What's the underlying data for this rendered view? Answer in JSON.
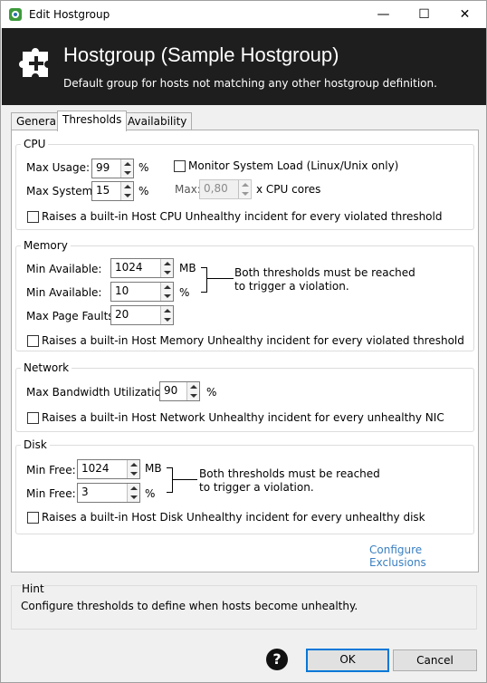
{
  "window": {
    "title": "Edit Hostgroup",
    "controls": {
      "minimize": "—",
      "maximize": "☐",
      "close": "✕"
    }
  },
  "header": {
    "title": "Hostgroup (Sample Hostgroup)",
    "subtitle": "Default group for hosts not matching any other hostgroup definition."
  },
  "tabs": [
    {
      "label": "General",
      "active": false
    },
    {
      "label": "Thresholds",
      "active": true
    },
    {
      "label": "Availability",
      "active": false
    }
  ],
  "cpu": {
    "legend": "CPU",
    "max_usage_label": "Max Usage:",
    "max_usage_value": "99",
    "max_usage_unit": "%",
    "max_system_label": "Max System:",
    "max_system_value": "15",
    "max_system_unit": "%",
    "monitor_load_label": "Monitor System Load (Linux/Unix only)",
    "monitor_load_checked": false,
    "max_label": "Max:",
    "max_value": "0,80",
    "max_unit": "x CPU cores",
    "incident_label": "Raises a built-in Host CPU Unhealthy incident for every violated threshold",
    "incident_checked": false
  },
  "memory": {
    "legend": "Memory",
    "min_available_label": "Min Available:",
    "min_available_mb_value": "1024",
    "min_available_mb_unit": "MB",
    "min_available_pct_label": "Min Available:",
    "min_available_pct_value": "10",
    "min_available_pct_unit": "%",
    "note_line1": "Both thresholds must be reached",
    "note_line2": "to trigger a violation.",
    "max_page_faults_label": "Max Page Faults:",
    "max_page_faults_value": "20",
    "incident_label": "Raises a built-in Host Memory Unhealthy incident for every violated threshold",
    "incident_checked": false
  },
  "network": {
    "legend": "Network",
    "max_bandwidth_label": "Max Bandwidth Utilization:",
    "max_bandwidth_value": "90",
    "max_bandwidth_unit": "%",
    "incident_label": "Raises a built-in Host Network Unhealthy incident for every unhealthy NIC",
    "incident_checked": false
  },
  "disk": {
    "legend": "Disk",
    "min_free_mb_label": "Min Free:",
    "min_free_mb_value": "1024",
    "min_free_mb_unit": "MB",
    "min_free_pct_label": "Min Free:",
    "min_free_pct_value": "3",
    "min_free_pct_unit": "%",
    "note_line1": "Both thresholds must be reached",
    "note_line2": "to trigger a violation.",
    "incident_label": "Raises a built-in Host Disk Unhealthy incident for every unhealthy disk",
    "incident_checked": false
  },
  "configure_exclusions": "Configure Exclusions",
  "hint": {
    "label": "Hint",
    "text": "Configure thresholds to define when hosts become unhealthy."
  },
  "footer": {
    "help": "?",
    "ok": "OK",
    "cancel": "Cancel"
  },
  "colors": {
    "header_bg": "#1e1e1e",
    "link": "#3a7fc1",
    "primary_border": "#0078d7"
  }
}
